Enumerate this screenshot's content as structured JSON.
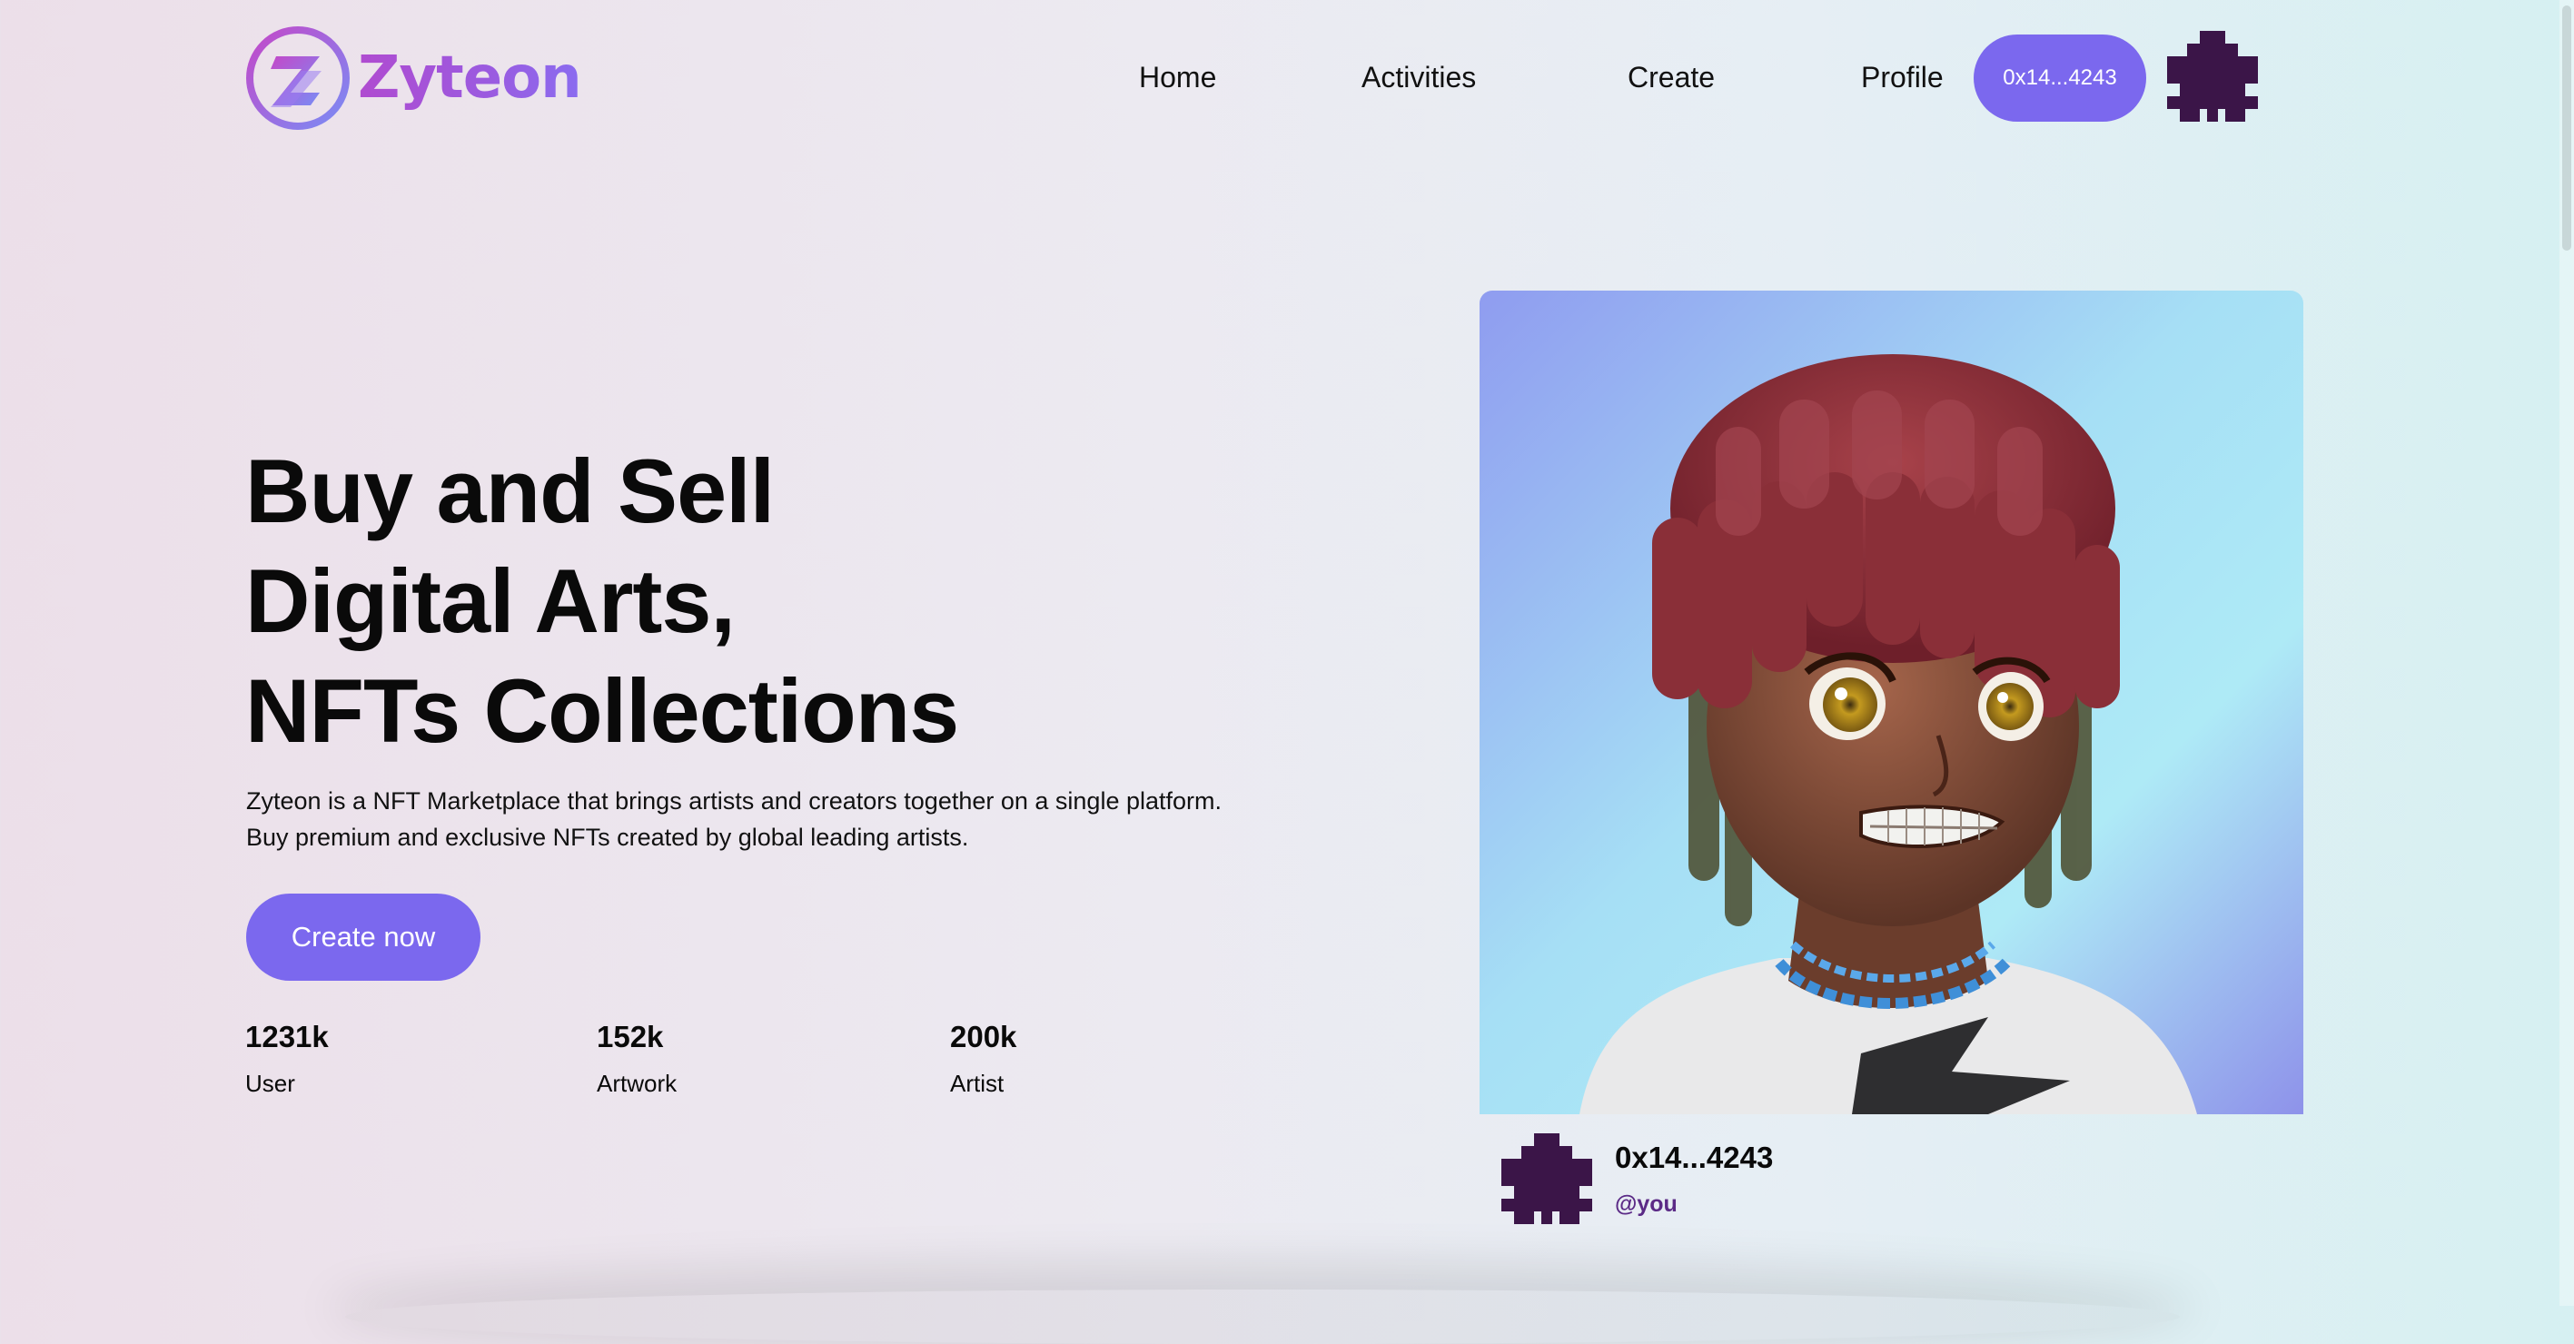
{
  "brand": {
    "name": "Zyteon",
    "logo_icon": "z-logo-icon"
  },
  "nav": {
    "items": [
      {
        "label": "Home"
      },
      {
        "label": "Activities"
      },
      {
        "label": "Create"
      },
      {
        "label": "Profile"
      }
    ],
    "wallet_label": "0x14...4243",
    "avatar_icon": "puzzle-avatar-icon"
  },
  "hero": {
    "title_lines": [
      "Buy and Sell",
      "Digital Arts,",
      "NFTs Collections"
    ],
    "description_lines": [
      "Zyteon is a NFT Marketplace that brings artists and creators together on a single platform.",
      "Buy premium and exclusive NFTs created by global leading artists."
    ],
    "cta_label": "Create now"
  },
  "stats": [
    {
      "value": "1231k",
      "label": "User"
    },
    {
      "value": "152k",
      "label": "Artwork"
    },
    {
      "value": "200k",
      "label": "Artist"
    }
  ],
  "featured": {
    "image": "anime-character-red-dreadlocks-artwork",
    "owner_address": "0x14...4243",
    "owner_handle": "@you",
    "owner_avatar_icon": "puzzle-avatar-icon"
  },
  "colors": {
    "accent": "#7b68ee",
    "avatar": "#3b1548",
    "handle": "#5b2a86",
    "logo_gradient_start": "#b04bd0",
    "logo_gradient_end": "#8a6cf0"
  }
}
